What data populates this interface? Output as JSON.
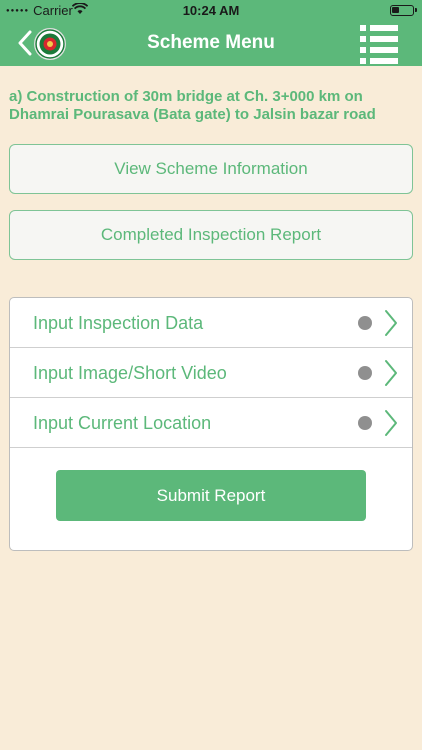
{
  "status_bar": {
    "carrier": "Carrier",
    "time": "10:24 AM"
  },
  "nav": {
    "title": "Scheme Menu",
    "logo_icon": "bangladesh-emblem-icon",
    "menu_icon": "list-menu-icon"
  },
  "scheme": {
    "title": "a) Construction of 30m bridge at Ch. 3+000 km on Dhamrai Pourasava (Bata gate) to Jalsin bazar road"
  },
  "actions": {
    "view_scheme": "View Scheme Information",
    "completed_report": "Completed Inspection Report"
  },
  "inputs": {
    "items": [
      {
        "label": "Input Inspection Data"
      },
      {
        "label": "Input Image/Short Video"
      },
      {
        "label": "Input Current Location"
      }
    ],
    "submit": "Submit Report"
  },
  "colors": {
    "brand_green": "#5cb87a",
    "background": "#f9ecd8",
    "status_dot": "#8f8f8f"
  }
}
